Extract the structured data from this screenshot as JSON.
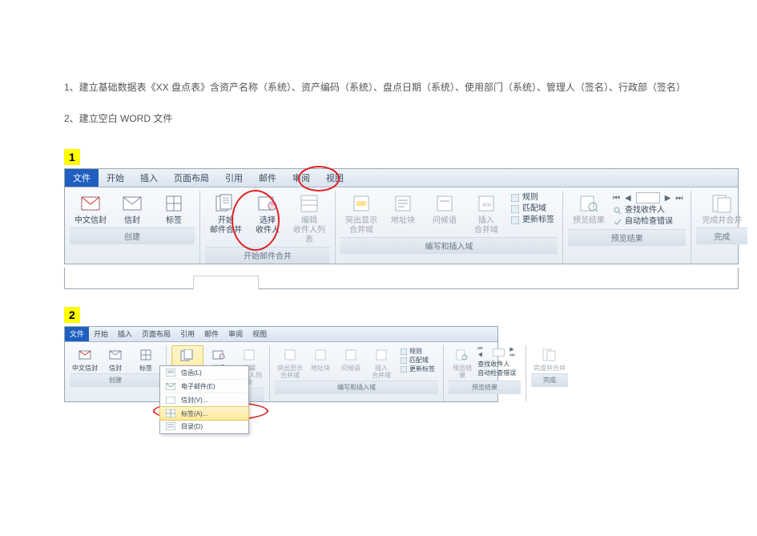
{
  "instructions": {
    "line1": "1、建立基础数据表《XX 盘点表》含资产名称（系统）、资产编码（系统）、盘点日期（系统）、使用部门（系统）、管理人（签名）、行政部（签名）",
    "line2": "2、建立空白 WORD 文件"
  },
  "badges": {
    "one": "1",
    "two": "2"
  },
  "tabs": {
    "file": "文件",
    "home": "开始",
    "insert": "插入",
    "layout": "页面布局",
    "references": "引用",
    "mailings": "邮件",
    "review": "审阅",
    "view": "视图"
  },
  "groups": {
    "create": {
      "title": "创建",
      "btn_cn_envelope": "中文信封",
      "btn_envelope": "信封",
      "btn_label": "标签"
    },
    "start_merge": {
      "title": "开始邮件合并",
      "btn_start": "开始\n邮件合并",
      "btn_select": "选择\n收件人",
      "btn_edit": "编辑\n收件人列表"
    },
    "write_insert": {
      "title": "编写和插入域",
      "btn_highlight": "突出显示\n合并域",
      "btn_address": "地址块",
      "btn_greeting": "问候语",
      "btn_insert": "插入\n合并域",
      "mini_rules": "规则",
      "mini_match": "匹配域",
      "mini_update": "更新标签"
    },
    "preview": {
      "title": "预览结果",
      "btn_preview": "预览结果",
      "mini_find": "查找收件人",
      "mini_check": "自动检查错误"
    },
    "finish": {
      "title": "完成",
      "btn_finish": "完成并合并"
    }
  },
  "dropdown": {
    "letters": "信函(L)",
    "email": "电子邮件(E)",
    "envelopes": "信封(V)...",
    "labels": "标签(A)...",
    "directory": "目录(D)"
  },
  "colors": {
    "accent": "#1f5fbf",
    "annot": "#d22",
    "badge": "#ffff00"
  }
}
